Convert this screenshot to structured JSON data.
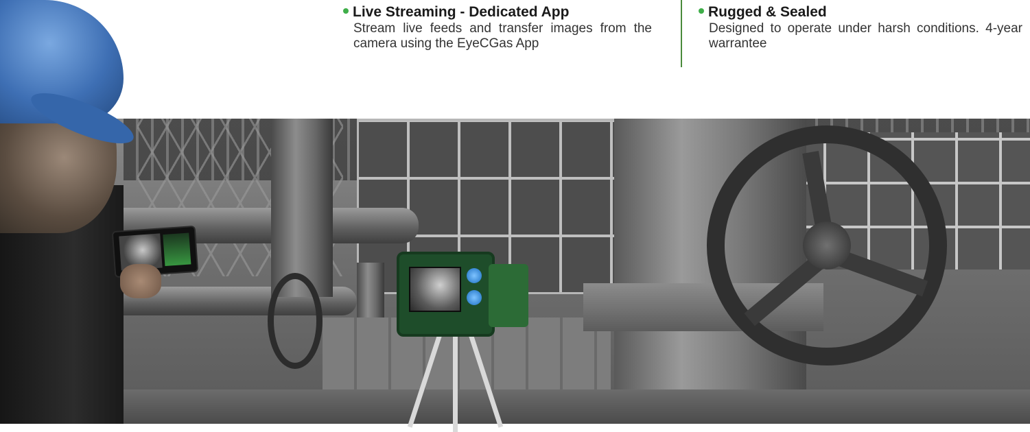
{
  "features": [
    {
      "title": "Live Streaming - Dedicated App",
      "description": "Stream live feeds and transfer images from the camera using the EyeCGas App"
    },
    {
      "title": "Rugged & Sealed",
      "description": "Designed to operate under harsh conditions. 4-year warrantee"
    }
  ],
  "colors": {
    "accent": "#3fae49",
    "divider": "#4a8a3c",
    "title_text": "#1a1a1a",
    "body_text": "#333333"
  },
  "icons": {
    "bullet": "green-bullet-icon"
  }
}
